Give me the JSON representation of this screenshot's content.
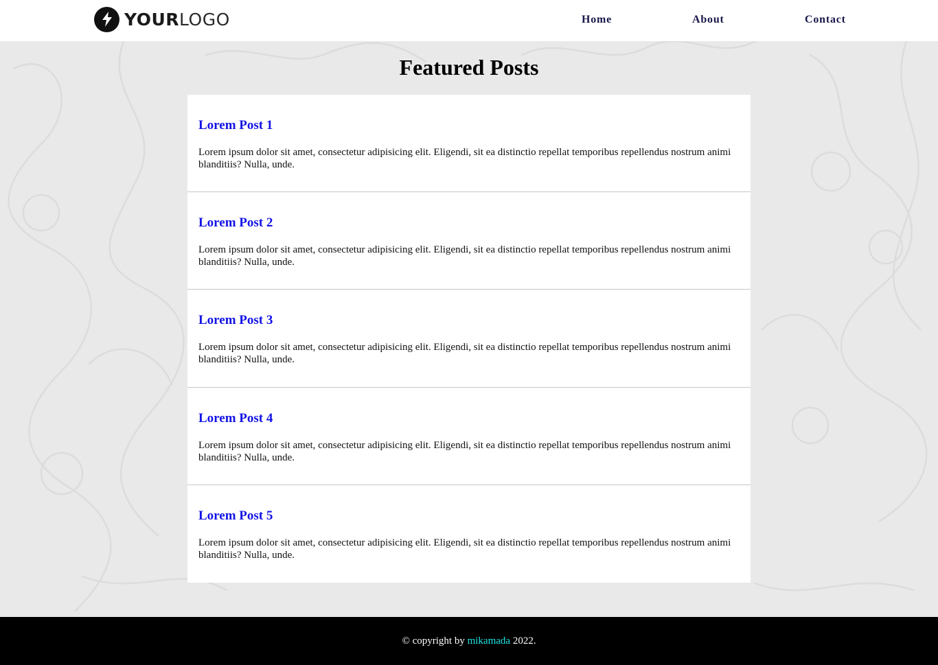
{
  "header": {
    "logo": {
      "bold_text": "YOUR",
      "light_text": "LOGO",
      "icon": "lightning-bolt-icon"
    },
    "nav": [
      {
        "label": "Home"
      },
      {
        "label": "About"
      },
      {
        "label": "Contact"
      }
    ]
  },
  "main": {
    "title": "Featured Posts",
    "posts": [
      {
        "title": "Lorem Post 1",
        "body": "Lorem ipsum dolor sit amet, consectetur adipisicing elit. Eligendi, sit ea distinctio repellat temporibus repellendus nostrum animi blanditiis? Nulla, unde."
      },
      {
        "title": "Lorem Post 2",
        "body": "Lorem ipsum dolor sit amet, consectetur adipisicing elit. Eligendi, sit ea distinctio repellat temporibus repellendus nostrum animi blanditiis? Nulla, unde."
      },
      {
        "title": "Lorem Post 3",
        "body": "Lorem ipsum dolor sit amet, consectetur adipisicing elit. Eligendi, sit ea distinctio repellat temporibus repellendus nostrum animi blanditiis? Nulla, unde."
      },
      {
        "title": "Lorem Post 4",
        "body": "Lorem ipsum dolor sit amet, consectetur adipisicing elit. Eligendi, sit ea distinctio repellat temporibus repellendus nostrum animi blanditiis? Nulla, unde."
      },
      {
        "title": "Lorem Post 5",
        "body": "Lorem ipsum dolor sit amet, consectetur adipisicing elit. Eligendi, sit ea distinctio repellat temporibus repellendus nostrum animi blanditiis? Nulla, unde."
      }
    ]
  },
  "footer": {
    "prefix": "© copyright by ",
    "author": "mikamada",
    "suffix": " 2022."
  },
  "colors": {
    "page_background": "#e9e9e9",
    "post_title": "#1212e6",
    "nav_text": "#17174a",
    "footer_background": "#000000",
    "footer_link": "#22e6e6"
  }
}
